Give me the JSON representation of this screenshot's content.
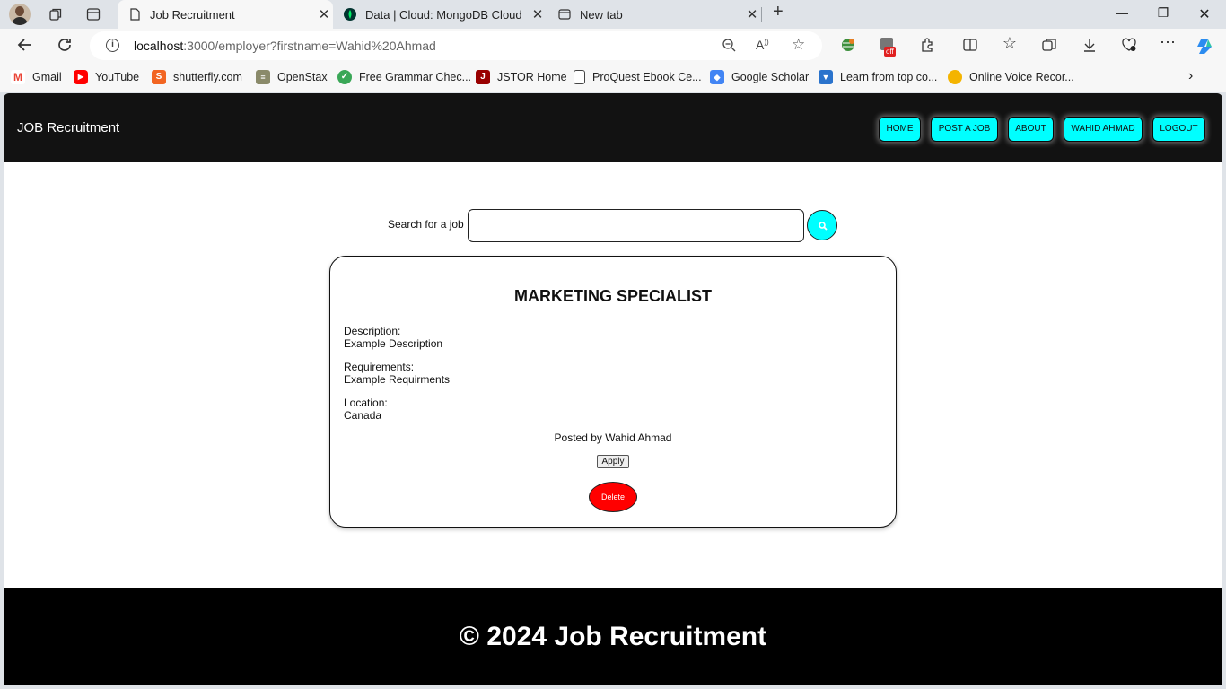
{
  "browser": {
    "tabs": [
      {
        "title": "Job Recruitment",
        "active": true
      },
      {
        "title": "Data | Cloud: MongoDB Cloud",
        "active": false
      },
      {
        "title": "New tab",
        "active": false
      }
    ],
    "new_tab_label": "+",
    "address": {
      "host": "localhost",
      "path": ":3000/employer?firstname=Wahid%20Ahmad"
    },
    "bookmarks": [
      {
        "label": "Gmail",
        "icon": "gmail-icon",
        "color": "#ea4335"
      },
      {
        "label": "YouTube",
        "icon": "youtube-icon",
        "color": "#ff0000"
      },
      {
        "label": "shutterfly.com",
        "icon": "shutterfly-icon",
        "color": "#f26522"
      },
      {
        "label": "OpenStax",
        "icon": "openstax-icon",
        "color": "#8a8a6a"
      },
      {
        "label": "Free Grammar Chec...",
        "icon": "grammar-icon",
        "color": "#3aa757"
      },
      {
        "label": "JSTOR Home",
        "icon": "jstor-icon",
        "color": "#990000"
      },
      {
        "label": "ProQuest Ebook Ce...",
        "icon": "document-icon",
        "color": "#ffffff"
      },
      {
        "label": "Google Scholar",
        "icon": "scholar-icon",
        "color": "#4285f4"
      },
      {
        "label": "Learn from top co...",
        "icon": "coursera-icon",
        "color": "#2a73cc"
      },
      {
        "label": "Online Voice Recor...",
        "icon": "voice-recorder-icon",
        "color": "#f4b400"
      }
    ],
    "extension_badge": "off"
  },
  "site": {
    "brand": "JOB Recruitment",
    "nav": [
      "HOME",
      "POST A JOB",
      "ABOUT",
      "WAHID AHMAD",
      "LOGOUT"
    ],
    "search_label": "Search for a job",
    "search_value": "",
    "job": {
      "title": "MARKETING SPECIALIST",
      "description_label": "Description:",
      "description": "Example Description",
      "requirements_label": "Requirements:",
      "requirements": "Example Requirments",
      "location_label": "Location:",
      "location": "Canada",
      "posted_by": "Posted by Wahid Ahmad",
      "apply_label": "Apply",
      "delete_label": "Delete"
    },
    "footer": "© 2024 Job Recruitment"
  },
  "colors": {
    "accent": "#00ffff",
    "header_bg": "#121212",
    "footer_bg": "#000000",
    "delete": "#ff0000"
  }
}
